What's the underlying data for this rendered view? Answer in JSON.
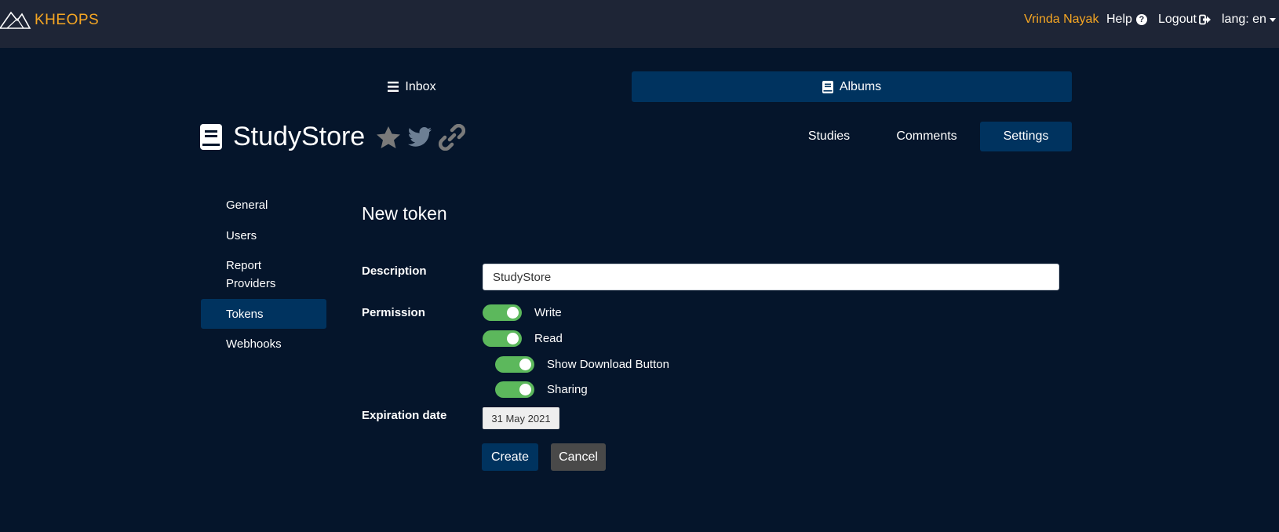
{
  "navbar": {
    "brand": "KHEOPS",
    "user_name": "Vrinda Nayak",
    "help_label": "Help",
    "help_icon_glyph": "?",
    "logout_label": "Logout",
    "lang_label": "lang: en",
    "accent_color": "#f5a623",
    "background_color": "#1e2536"
  },
  "main_tabs": [
    {
      "label": "Inbox",
      "icon": "hamburger-icon",
      "active": false
    },
    {
      "label": "Albums",
      "icon": "book-icon",
      "active": true
    }
  ],
  "album": {
    "title": "StudyStore",
    "icon": "book-icon",
    "actions": [
      "star-icon",
      "twitter-icon",
      "link-icon"
    ]
  },
  "album_tabs": [
    {
      "label": "Studies",
      "active": false
    },
    {
      "label": "Comments",
      "active": false
    },
    {
      "label": "Settings",
      "active": true
    }
  ],
  "settings_menu": [
    {
      "label": "General",
      "active": false
    },
    {
      "label": "Users",
      "active": false
    },
    {
      "label": "Report Providers",
      "active": false
    },
    {
      "label": "Tokens",
      "active": true
    },
    {
      "label": "Webhooks",
      "active": false
    }
  ],
  "form": {
    "title": "New token",
    "description_label": "Description",
    "description_value": "StudyStore",
    "permission_label": "Permission",
    "permissions": [
      {
        "label": "Write",
        "enabled": true
      },
      {
        "label": "Read",
        "enabled": true
      },
      {
        "label": "Show Download Button",
        "enabled": true
      },
      {
        "label": "Sharing",
        "enabled": true
      }
    ],
    "expiration_label": "Expiration date",
    "expiration_value": "31 May 2021",
    "create_label": "Create",
    "cancel_label": "Cancel"
  },
  "colors": {
    "page_background": "#05152b",
    "active_tab": "#00335f",
    "toggle_on": "#5cb85c",
    "cancel_button": "#494949"
  }
}
